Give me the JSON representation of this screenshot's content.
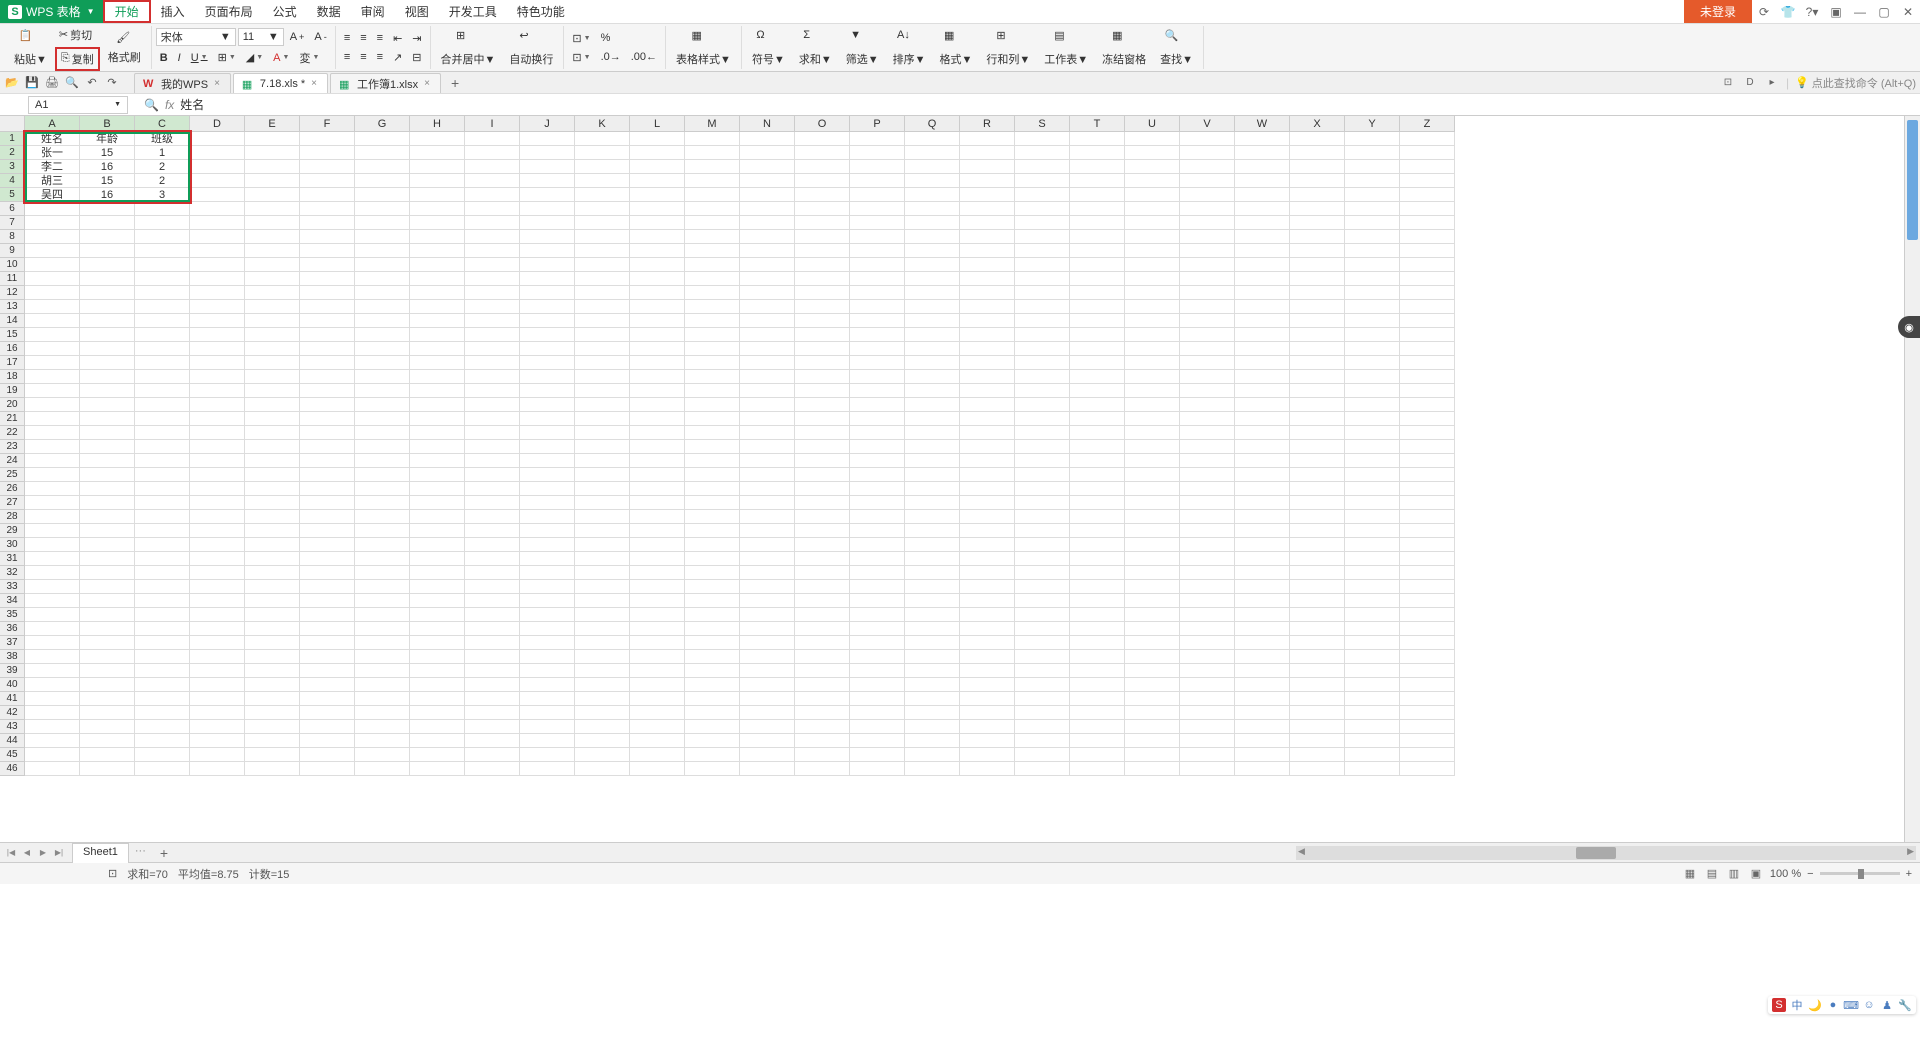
{
  "app": {
    "name": "WPS 表格",
    "login": "未登录"
  },
  "menu": {
    "items": [
      "开始",
      "插入",
      "页面布局",
      "公式",
      "数据",
      "审阅",
      "视图",
      "开发工具",
      "特色功能"
    ],
    "active_index": 0
  },
  "ribbon": {
    "paste": "粘贴",
    "cut": "剪切",
    "copy": "复制",
    "format_painter": "格式刷",
    "font_name": "宋体",
    "font_size": "11",
    "merge_center": "合并居中",
    "auto_wrap": "自动换行",
    "table_style": "表格样式",
    "symbol": "符号",
    "sum": "求和",
    "filter": "筛选",
    "sort": "排序",
    "format": "格式",
    "row_col": "行和列",
    "worksheet": "工作表",
    "freeze": "冻结窗格",
    "find": "查找"
  },
  "quick_access": {
    "search_hint": "点此查找命令 (Alt+Q)"
  },
  "file_tabs": {
    "items": [
      {
        "label": "我的WPS",
        "type": "wps"
      },
      {
        "label": "7.18.xls *",
        "type": "xls"
      },
      {
        "label": "工作簿1.xlsx",
        "type": "xlsx"
      }
    ]
  },
  "name_box": "A1",
  "formula_value": "姓名",
  "columns": [
    "A",
    "B",
    "C",
    "D",
    "E",
    "F",
    "G",
    "H",
    "I",
    "J",
    "K",
    "L",
    "M",
    "N",
    "O",
    "P",
    "Q",
    "R",
    "S",
    "T",
    "U",
    "V",
    "W",
    "X",
    "Y",
    "Z"
  ],
  "row_count": 46,
  "selected_cols": 3,
  "selected_rows": 5,
  "cell_data": [
    [
      "姓名",
      "年龄",
      "班级"
    ],
    [
      "张一",
      "15",
      "1"
    ],
    [
      "李二",
      "16",
      "2"
    ],
    [
      "胡三",
      "15",
      "2"
    ],
    [
      "吴四",
      "16",
      "3"
    ]
  ],
  "sheet": {
    "name": "Sheet1"
  },
  "status": {
    "sum": "求和=70",
    "avg": "平均值=8.75",
    "count": "计数=15",
    "zoom": "100 %"
  }
}
